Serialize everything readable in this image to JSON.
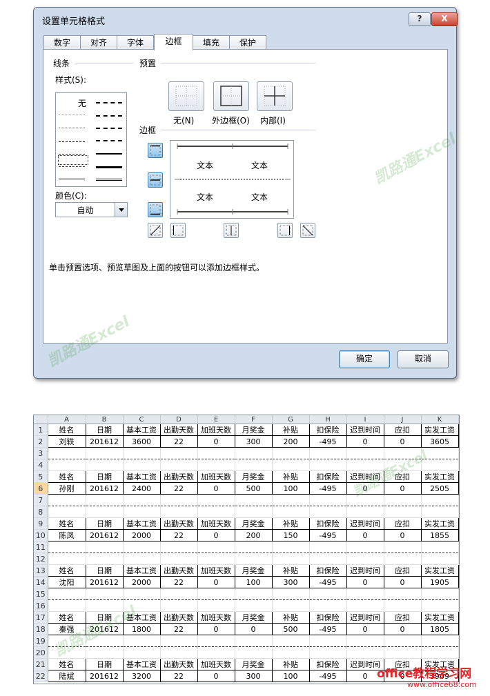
{
  "dialog": {
    "title": "设置单元格格式",
    "help_glyph": "?",
    "close_glyph": "X",
    "tabs": [
      "数字",
      "对齐",
      "字体",
      "边框",
      "填充",
      "保护"
    ],
    "active_tab": "边框",
    "line_group": "线条",
    "style_label": "样式(S):",
    "style_none": "无",
    "color_label": "颜色(C):",
    "color_value": "自动",
    "presets_group": "预置",
    "presets": [
      "无(N)",
      "外边框(O)",
      "内部(I)"
    ],
    "border_group": "边框",
    "preview_text": "文本",
    "hint": "单击预置选项、预览草图及上面的按钮可以添加边框样式。",
    "ok": "确定",
    "cancel": "取消",
    "watermark": "凯路通Excel"
  },
  "sheet": {
    "columns": [
      "A",
      "B",
      "C",
      "D",
      "E",
      "F",
      "G",
      "H",
      "I",
      "J",
      "K"
    ],
    "headers": [
      "姓名",
      "日期",
      "基本工资",
      "出勤天数",
      "加班天数",
      "月奖金",
      "补贴",
      "扣保险",
      "迟到时间",
      "应扣",
      "实发工资"
    ],
    "records": [
      [
        "刘轶",
        "201612",
        "3600",
        "22",
        "0",
        "300",
        "200",
        "-495",
        "0",
        "0",
        "3605"
      ],
      [
        "孙刚",
        "201612",
        "2400",
        "22",
        "0",
        "500",
        "100",
        "-495",
        "0",
        "0",
        "2505"
      ],
      [
        "陈凤",
        "201612",
        "2000",
        "22",
        "0",
        "200",
        "150",
        "-495",
        "0",
        "0",
        "1855"
      ],
      [
        "沈阳",
        "201612",
        "2000",
        "22",
        "0",
        "100",
        "300",
        "-495",
        "0",
        "0",
        "1905"
      ],
      [
        "秦强",
        "201612",
        "1800",
        "22",
        "0",
        "0",
        "500",
        "-495",
        "0",
        "0",
        "1805"
      ],
      [
        "陆斌",
        "201612",
        "3200",
        "22",
        "0",
        "300",
        "100",
        "-495",
        "0",
        "0",
        "3909"
      ]
    ],
    "row_numbers": [
      "1",
      "2",
      "3",
      "4",
      "5",
      "6",
      "7",
      "8",
      "9",
      "10",
      "11",
      "12",
      "13",
      "14",
      "15",
      "16",
      "17",
      "18",
      "19",
      "20",
      "21",
      "22"
    ],
    "selected_row": "6"
  },
  "site_logo": "office教程学习网",
  "site_url": "www.office68.com"
}
